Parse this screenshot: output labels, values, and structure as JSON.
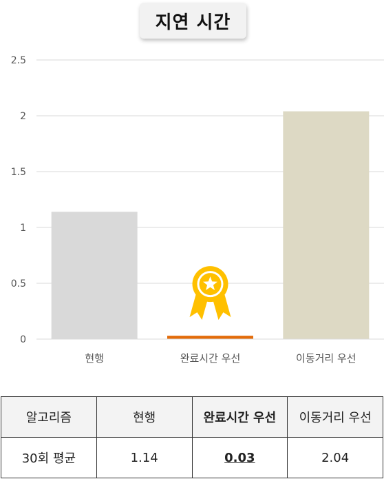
{
  "chart_data": {
    "type": "bar",
    "title": "지연 시간",
    "categories": [
      "현행",
      "완료시간 우선",
      "이동거리 우선"
    ],
    "values": [
      1.14,
      0.03,
      2.04
    ],
    "ylim": [
      0,
      2.5
    ],
    "yticks": [
      "0",
      "0.5",
      "1",
      "1.5",
      "2",
      "2.5"
    ],
    "ytick_values": [
      0,
      0.5,
      1,
      1.5,
      2,
      2.5
    ],
    "grid": true,
    "bar_colors": [
      "#d9d9d9",
      "#e36c0a",
      "#ddd9c4"
    ],
    "highlight": {
      "category": "완료시간 우선",
      "icon": "award-medal-icon",
      "color": "#ffc000"
    }
  },
  "table": {
    "headers": [
      "알고리즘",
      "현행",
      "완료시간 우선",
      "이동거리 우선"
    ],
    "rows": [
      [
        "30회 평균",
        "1.14",
        "0.03",
        "2.04"
      ]
    ]
  }
}
